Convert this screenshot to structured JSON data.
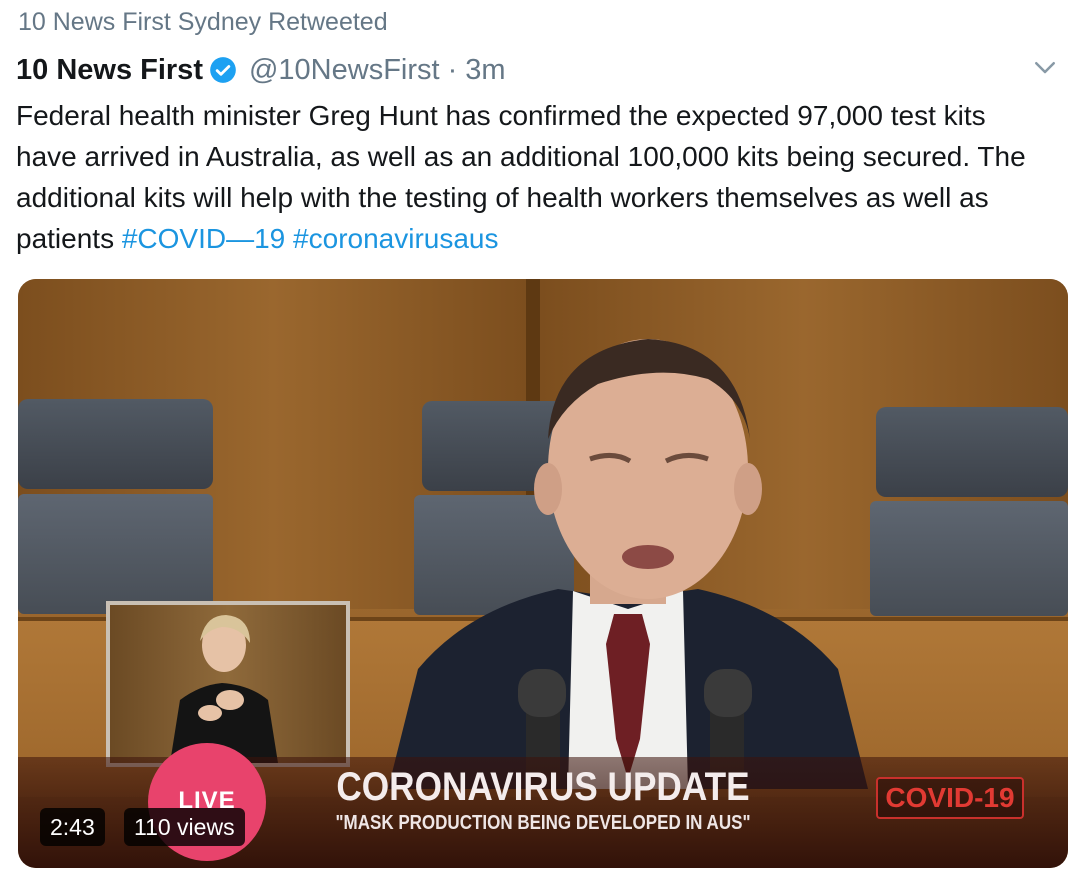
{
  "retweet": {
    "text": "10 News First Sydney Retweeted"
  },
  "tweet": {
    "display_name": "10 News First",
    "handle": "@10NewsFirst",
    "separator": "·",
    "time": "3m",
    "text": "Federal health minister Greg Hunt has confirmed the expected 97,000 test kits have arrived in Australia, as well as an additional 100,000 kits being secured. The additional kits will help with the testing of health workers themselves as well as patients ",
    "hashtags": [
      "#COVID—19",
      "#coronavirusaus"
    ]
  },
  "video": {
    "banner_title": "CORONAVIRUS UPDATE",
    "banner_subtitle": "\"MASK PRODUCTION BEING DEVELOPED IN AUS\"",
    "badge": "COVID-19",
    "live": "LIVE",
    "duration": "2:43",
    "views": "110 views"
  },
  "icons": {
    "verified": "verified-badge-icon",
    "menu": "chevron-down-icon"
  },
  "colors": {
    "link": "#1b95e0",
    "muted": "#657786",
    "verified": "#1da1f2",
    "live": "#e8436c"
  }
}
